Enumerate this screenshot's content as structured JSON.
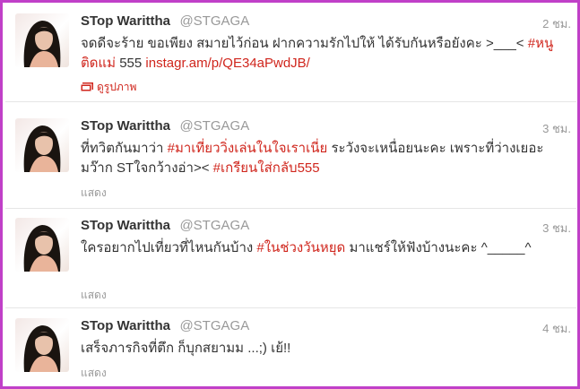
{
  "tweets": [
    {
      "full_name": "STop Warittha",
      "screen_name": "@STGAGA",
      "time": "2 ชม.",
      "text_parts": [
        {
          "type": "text",
          "value": "จดดีจะร้าย ขอเพียง สมายไว้ก่อน ฝากความรักไปให้ ได้รับกันหรือยังคะ >___< "
        },
        {
          "type": "hashtag",
          "value": "#หนูติดแม่"
        },
        {
          "type": "text",
          "value": " 555 "
        },
        {
          "type": "link",
          "value": "instagr.am/p/QE34aPwdJB/"
        }
      ],
      "action": {
        "label": "ดูรูปภาพ",
        "icon": "photo-icon"
      }
    },
    {
      "full_name": "STop Warittha",
      "screen_name": "@STGAGA",
      "time": "3 ชม.",
      "text_parts": [
        {
          "type": "text",
          "value": "ที่ทวิตกันมาว่า "
        },
        {
          "type": "hashtag",
          "value": "#มาเที่ยววิ่งเล่นในใจเราเนี่ย"
        },
        {
          "type": "text",
          "value": " ระวังจะเหนื่อยนะคะ เพราะที่ว่างเยอะมว๊าก STใจกว้างอ่า>< "
        },
        {
          "type": "hashtag",
          "value": "#เกรียนใส่กลับ555"
        }
      ],
      "action": {
        "label": "แสดง"
      }
    },
    {
      "full_name": "STop Warittha",
      "screen_name": "@STGAGA",
      "time": "3 ชม.",
      "text_parts": [
        {
          "type": "text",
          "value": "ใครอยากไปเที่ยวที่ไหนกันบ้าง "
        },
        {
          "type": "hashtag",
          "value": "#ในช่วงวันหยุด"
        },
        {
          "type": "text",
          "value": " มาแชร์ให้ฟังบ้างนะคะ ^_____^"
        }
      ],
      "action": {
        "label": "แสดง"
      }
    },
    {
      "full_name": "STop Warittha",
      "screen_name": "@STGAGA",
      "time": "4 ชม.",
      "text_parts": [
        {
          "type": "text",
          "value": "เสร็จภารกิจที่ตึก ก็บุกสยามม ...;) เย้!!"
        }
      ],
      "action": {
        "label": "แสดง"
      }
    }
  ],
  "colors": {
    "frame_border": "#c040c8",
    "hashtag": "#d0261d",
    "name": "#333333",
    "meta": "#999999",
    "divider": "#e6e6e6"
  }
}
